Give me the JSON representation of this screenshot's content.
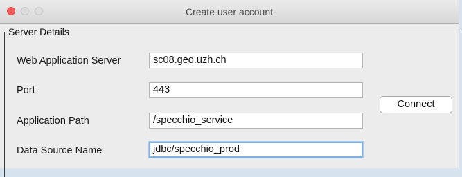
{
  "window": {
    "title": "Create user account"
  },
  "server_details": {
    "legend": "Server Details",
    "web_application_server": {
      "label": "Web Application Server",
      "value": "sc08.geo.uzh.ch"
    },
    "port": {
      "label": "Port",
      "value": "443"
    },
    "application_path": {
      "label": "Application Path",
      "value": "/specchio_service"
    },
    "data_source_name": {
      "label": "Data Source Name",
      "value": "jdbc/specchio_prod"
    },
    "connect_label": "Connect"
  },
  "colors": {
    "close_button": "#fc605c",
    "focus_ring": "#7fb0e0",
    "window_bg": "#ececec"
  }
}
